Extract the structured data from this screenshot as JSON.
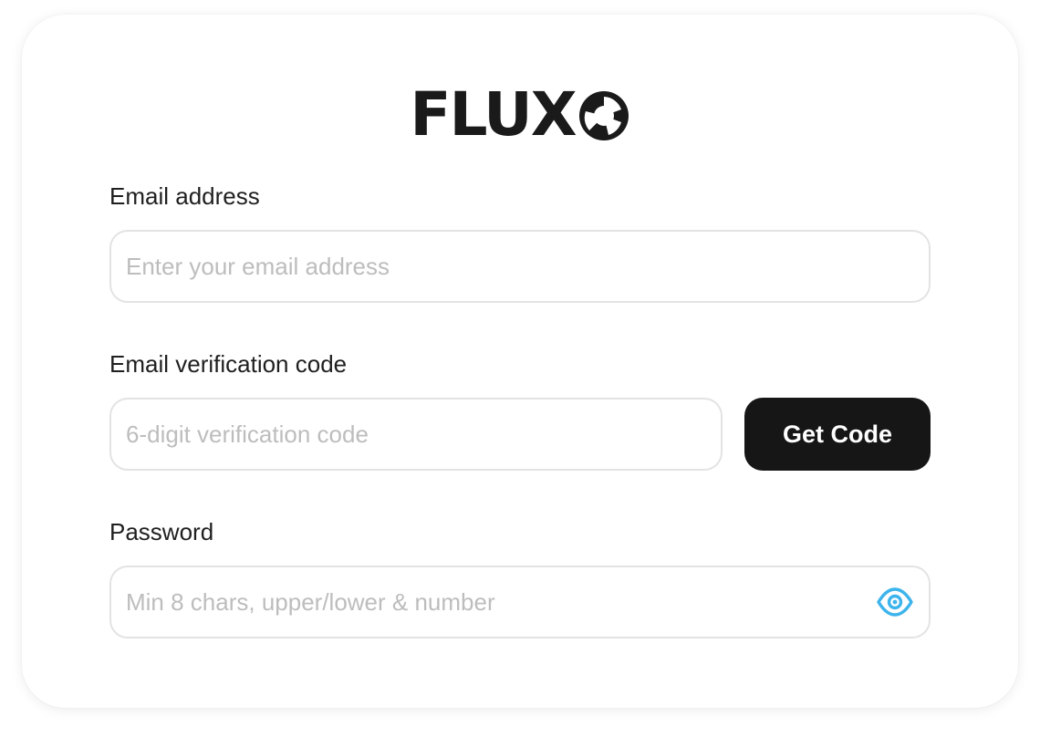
{
  "brand": {
    "name": "FLUX",
    "accent": "#3cb4ec",
    "dark": "#161616"
  },
  "form": {
    "email": {
      "label": "Email address",
      "placeholder": "Enter your email address",
      "value": ""
    },
    "verification": {
      "label": "Email verification code",
      "placeholder": "6-digit verification code",
      "value": "",
      "button_label": "Get Code"
    },
    "password": {
      "label": "Password",
      "placeholder": "Min 8 chars, upper/lower & number",
      "value": "",
      "toggle_icon": "eye-icon"
    }
  }
}
